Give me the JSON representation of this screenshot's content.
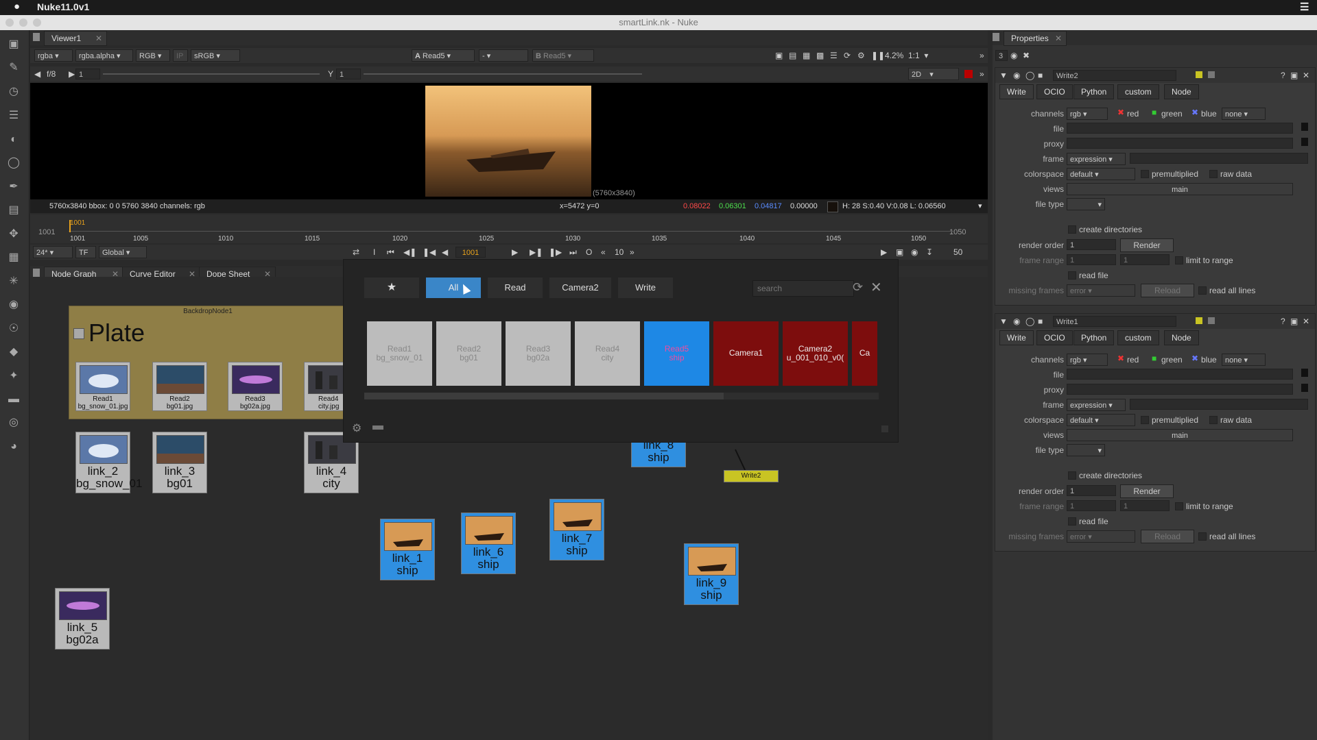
{
  "menubar": {
    "app": "Nuke11.0v1"
  },
  "window": {
    "title": "smartLink.nk - Nuke"
  },
  "viewer": {
    "tab": "Viewer1",
    "channels": "rgba",
    "alpha": "rgba.alpha",
    "colorspace_a": "RGB",
    "ip": "IP",
    "lut": "sRGB",
    "a_label": "A",
    "a_input": "Read5",
    "wipe": "-",
    "b_label": "B",
    "b_input": "Read5",
    "zoom": "4.2%",
    "ratio": "1:1",
    "mode": "2D",
    "fstop": "f/8",
    "gain": "1",
    "y_label": "Y",
    "gamma": "1",
    "res_label": "(5760x3840)",
    "info": "5760x3840  bbox: 0 0 5760 3840 channels: rgb",
    "coords": "x=5472 y=0",
    "r": "0.08022",
    "g": "0.06301",
    "b": "0.04817",
    "a": "0.00000",
    "hsv": "H: 28 S:0.40 V:0.08  L: 0.06560"
  },
  "timeline": {
    "start": "1001",
    "end": "1050",
    "current": "1001",
    "fps": "24*",
    "tf": "TF",
    "scope": "Global",
    "ticks": [
      "1001",
      "1005",
      "1010",
      "1015",
      "1020",
      "1025",
      "1030",
      "1035",
      "1040",
      "1045",
      "1050"
    ],
    "frame_field": "1001",
    "step": "10",
    "end_field": "50",
    "i_btn": "I",
    "o_btn": "O"
  },
  "node_tabs": [
    "Node Graph",
    "Curve Editor",
    "Dope Sheet"
  ],
  "backdrop": {
    "name": "BackdropNode1",
    "label": "Plate"
  },
  "read_nodes": [
    {
      "l1": "Read1",
      "l2": "bg_snow_01.jpg"
    },
    {
      "l1": "Read2",
      "l2": "bg01.jpg"
    },
    {
      "l1": "Read3",
      "l2": "bg02a.jpg"
    },
    {
      "l1": "Read4",
      "l2": "city.jpg"
    }
  ],
  "links": [
    {
      "l1": "link_2",
      "l2": "bg_snow_01"
    },
    {
      "l1": "link_3",
      "l2": "bg01"
    },
    {
      "l1": "link_4",
      "l2": "city"
    },
    {
      "l1": "link_1",
      "l2": "ship"
    },
    {
      "l1": "link_6",
      "l2": "ship"
    },
    {
      "l1": "link_7",
      "l2": "ship"
    },
    {
      "l1": "link_8",
      "l2": "ship"
    },
    {
      "l1": "link_9",
      "l2": "ship"
    },
    {
      "l1": "link_5",
      "l2": "bg02a"
    }
  ],
  "write_node": "Write2",
  "popup": {
    "tabs": [
      "All",
      "Read",
      "Camera2",
      "Write"
    ],
    "search_placeholder": "search",
    "cards": [
      {
        "l1": "Read1",
        "l2": "bg_snow_01"
      },
      {
        "l1": "Read2",
        "l2": "bg01"
      },
      {
        "l1": "Read3",
        "l2": "bg02a"
      },
      {
        "l1": "Read4",
        "l2": "city"
      },
      {
        "l1": "Read5",
        "l2": "ship"
      },
      {
        "l1": "Camera1",
        "l2": ""
      },
      {
        "l1": "Camera2",
        "l2": "u_001_010_v0("
      },
      {
        "l1": "Ca",
        "l2": ""
      }
    ]
  },
  "properties": {
    "tab": "Properties",
    "count": "3",
    "panels": [
      {
        "name": "Write2"
      },
      {
        "name": "Write1"
      }
    ],
    "subtabs": [
      "Write",
      "OCIO",
      "Python",
      "custom",
      "Node"
    ],
    "labels": {
      "channels": "channels",
      "file": "file",
      "proxy": "proxy",
      "frame": "frame",
      "colorspace": "colorspace",
      "views": "views",
      "file_type": "file type",
      "render_order": "render order",
      "frame_range": "frame range",
      "missing_frames": "missing frames"
    },
    "values": {
      "channels": "rgb",
      "red": "red",
      "green": "green",
      "blue": "blue",
      "none": "none",
      "frame": "expression",
      "colorspace": "default",
      "premultiplied": "premultiplied",
      "raw_data": "raw data",
      "views": "main",
      "create_dirs": "create directories",
      "render_order": "1",
      "render": "Render",
      "fr1": "1",
      "fr2": "1",
      "limit": "limit to range",
      "read_file": "read file",
      "missing": "error",
      "reload": "Reload",
      "read_all": "read all lines"
    }
  }
}
